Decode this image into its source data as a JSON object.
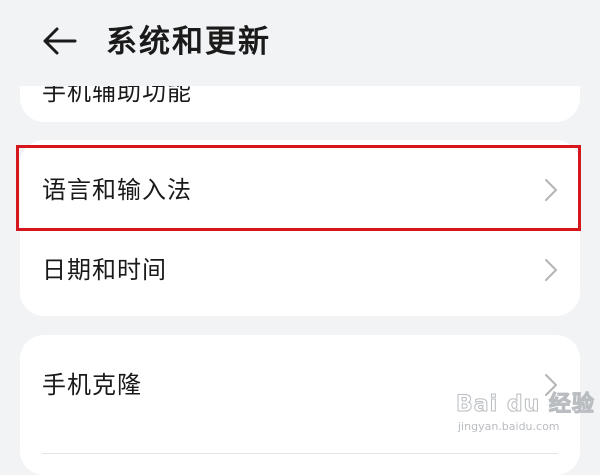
{
  "header": {
    "back_icon": "arrow-left-icon",
    "title": "系统和更新"
  },
  "top_card": {
    "partial_text": "手机辅助功能"
  },
  "group_a": {
    "items": [
      {
        "label": "语言和输入法",
        "icon": "chevron-right-icon"
      },
      {
        "label": "日期和时间",
        "icon": "chevron-right-icon"
      }
    ]
  },
  "group_b": {
    "items": [
      {
        "label": "手机克隆",
        "icon": "chevron-right-icon"
      }
    ]
  },
  "annotation": {
    "color": "#d5161d",
    "target": "语言和输入法"
  },
  "watermark": {
    "brand": "Bai du 经验",
    "url": "jingyan.baidu.com"
  }
}
